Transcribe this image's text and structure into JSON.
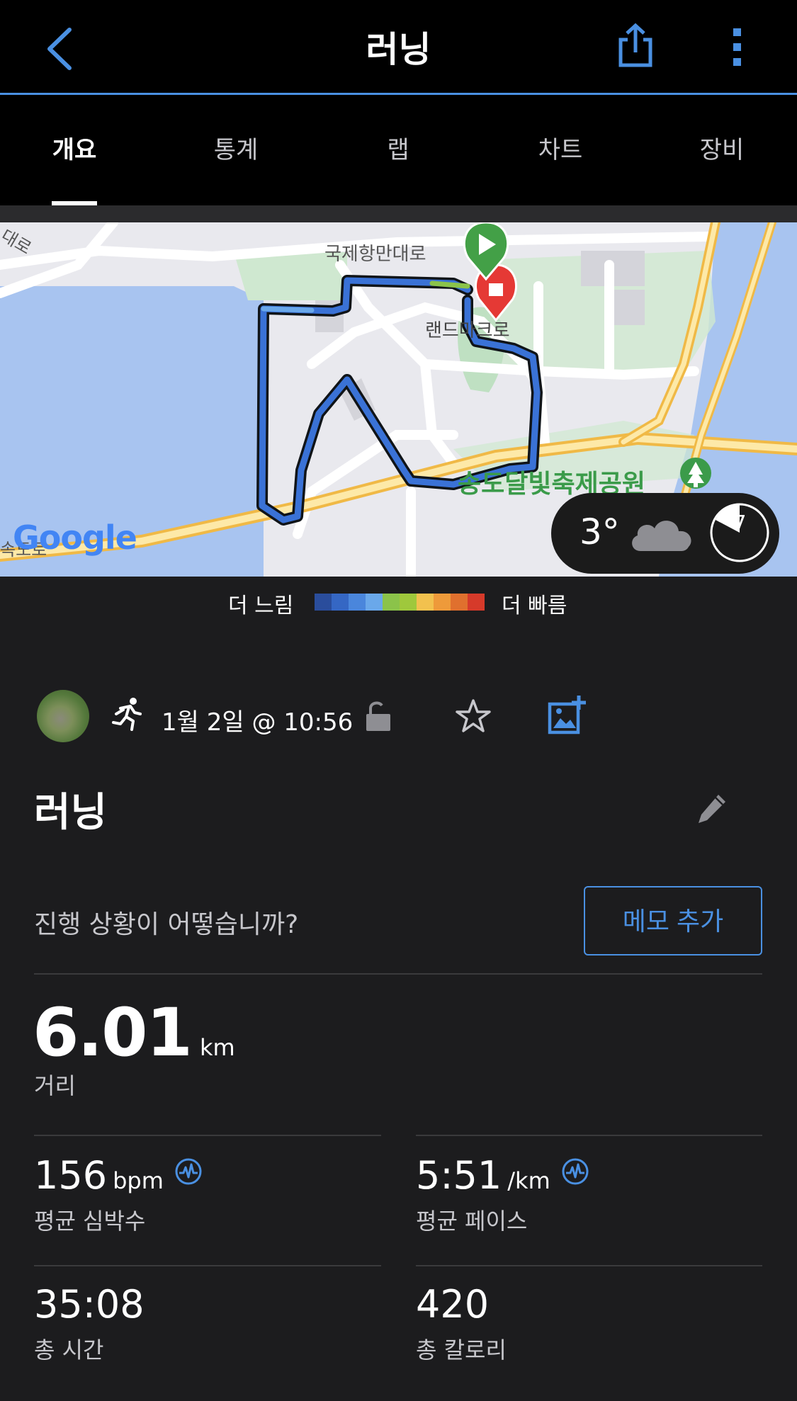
{
  "header": {
    "title": "러닝",
    "back_icon": "chevron-left-icon",
    "share_icon": "share-icon",
    "more_icon": "more-vertical-icon",
    "accent": "#4a90e2"
  },
  "tabs": [
    {
      "label": "개요",
      "active": true
    },
    {
      "label": "통계",
      "active": false
    },
    {
      "label": "랩",
      "active": false
    },
    {
      "label": "차트",
      "active": false
    },
    {
      "label": "장비",
      "active": false
    }
  ],
  "map": {
    "labels": {
      "road_top": "국제항만대로",
      "road_mid": "랜드마크로",
      "park": "송도달빛축제공원",
      "road_left": "대로",
      "road_bottom": "속도로",
      "logo": "Google"
    },
    "weather": {
      "temp": "3°",
      "icon": "cloud-icon",
      "uv_value": "7"
    }
  },
  "legend": {
    "slower": "더 느림",
    "faster": "더 빠름",
    "colors": [
      "#2a4d9c",
      "#3567c4",
      "#4a86dc",
      "#6aa8ea",
      "#8bc34a",
      "#9fc83c",
      "#f2c14e",
      "#ee9a3a",
      "#e0702e",
      "#d63a2a"
    ]
  },
  "activity": {
    "type_icon": "running-icon",
    "datetime": "1월 2일 @ 10:56",
    "title": "러닝",
    "prompt": "진행 상황이 어떻습니까?",
    "memo_button": "메모 추가"
  },
  "stats": {
    "distance": {
      "value": "6.01",
      "unit": "km",
      "label": "거리"
    },
    "avg_hr": {
      "value": "156",
      "unit": "bpm",
      "label": "평균 심박수"
    },
    "avg_pace": {
      "value": "5:51",
      "unit": "/km",
      "label": "평균 페이스"
    },
    "total_time": {
      "value": "35:08",
      "label": "총 시간"
    },
    "calories": {
      "value": "420",
      "label": "총 칼로리"
    }
  }
}
